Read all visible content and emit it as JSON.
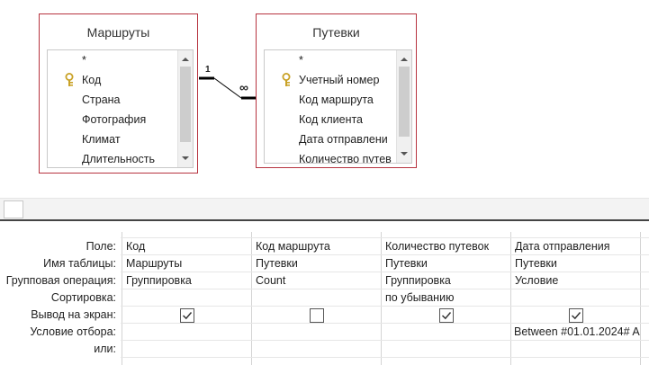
{
  "tables": [
    {
      "title": "Маршруты",
      "fields": [
        "*",
        "Код",
        "Страна",
        "Фотография",
        "Климат",
        "Длительность"
      ]
    },
    {
      "title": "Путевки",
      "fields": [
        "*",
        "Учетный номер",
        "Код маршрута",
        "Код клиента",
        "Дата отправлени",
        "Количество путев"
      ]
    }
  ],
  "relationship": {
    "one_label": "1",
    "many_label": "∞"
  },
  "grid": {
    "row_labels": [
      "Поле:",
      "Имя таблицы:",
      "Групповая операция:",
      "Сортировка:",
      "Вывод на экран:",
      "Условие отбора:",
      "или:"
    ],
    "columns": [
      {
        "field": "Код",
        "table": "Маршруты",
        "total": "Группировка",
        "sort": "",
        "show": true,
        "criteria": ""
      },
      {
        "field": "Код маршрута",
        "table": "Путевки",
        "total": "Count",
        "sort": "",
        "show": false,
        "criteria": ""
      },
      {
        "field": "Количество путевок",
        "table": "Путевки",
        "total": "Группировка",
        "sort": "по убыванию",
        "show": true,
        "criteria": ""
      },
      {
        "field": "Дата отправления",
        "table": "Путевки",
        "total": "Условие",
        "sort": "",
        "show": true,
        "criteria": "Between #01.01.2024# A"
      }
    ]
  },
  "colors": {
    "table_border": "#b7333f",
    "key_icon": "#c9a227"
  },
  "icons": {
    "primary_key": "key-icon",
    "scroll_up": "chevron-up-icon",
    "scroll_down": "chevron-down-icon",
    "checked": "checkmark-icon"
  }
}
